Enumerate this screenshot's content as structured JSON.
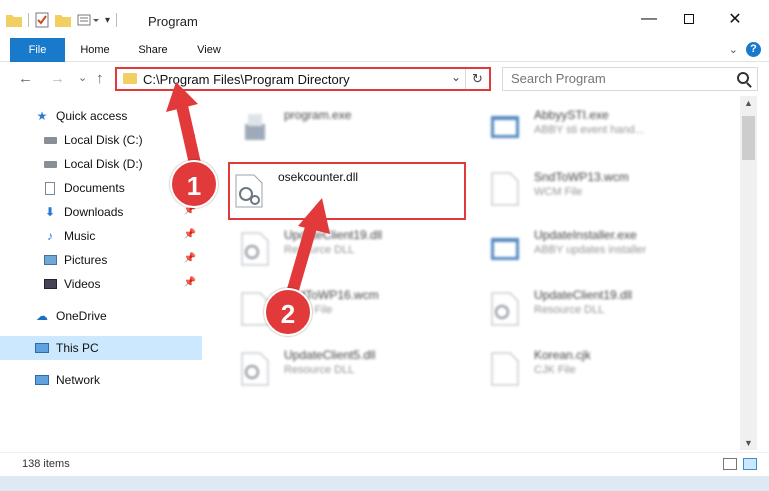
{
  "titlebar": {
    "title": "Program"
  },
  "ribbon": {
    "file": "File",
    "home": "Home",
    "share": "Share",
    "view": "View"
  },
  "navbar": {
    "back": "←",
    "forward": "→",
    "recent": "⌄",
    "up": "↑",
    "address": "C:\\Program Files\\Program Directory",
    "search_placeholder": "Search Program"
  },
  "sidebar": {
    "items": [
      {
        "label": "Quick access",
        "icon": "star-icon"
      },
      {
        "label": "Local Disk (C:)",
        "icon": "drive-icon"
      },
      {
        "label": "Local Disk (D:)",
        "icon": "drive-icon"
      },
      {
        "label": "Documents",
        "icon": "documents-icon"
      },
      {
        "label": "Downloads",
        "icon": "download-icon"
      },
      {
        "label": "Music",
        "icon": "music-icon"
      },
      {
        "label": "Pictures",
        "icon": "pictures-icon"
      },
      {
        "label": "Videos",
        "icon": "videos-icon"
      },
      {
        "label": "OneDrive",
        "icon": "cloud-icon"
      },
      {
        "label": "This PC",
        "icon": "pc-icon"
      },
      {
        "label": "Network",
        "icon": "network-icon"
      }
    ]
  },
  "files": [
    {
      "name": "program.exe",
      "desc": ""
    },
    {
      "name": "AbbyySTI.exe",
      "desc": "ABBY sti event hand..."
    },
    {
      "name": "osekcounter.dll",
      "desc": ""
    },
    {
      "name": "SndToWP13.wcm",
      "desc": "WCM File"
    },
    {
      "name": "UpdateClient19.dll",
      "desc": "Resource DLL"
    },
    {
      "name": "UpdateInstaller.exe",
      "desc": "ABBY updates installer"
    },
    {
      "name": "SndToWP16.wcm",
      "desc": "WCM File"
    },
    {
      "name": "UpdateClient19.dll",
      "desc": "Resource DLL"
    },
    {
      "name": "UpdateClient5.dll",
      "desc": "Resource DLL"
    },
    {
      "name": "Korean.cjk",
      "desc": "CJK File"
    }
  ],
  "status": {
    "items": "138 items"
  },
  "steps": {
    "one": "1",
    "two": "2"
  },
  "colors": {
    "accent": "#1979ca",
    "highlight": "#e23a3a",
    "selected": "#cce8ff"
  }
}
